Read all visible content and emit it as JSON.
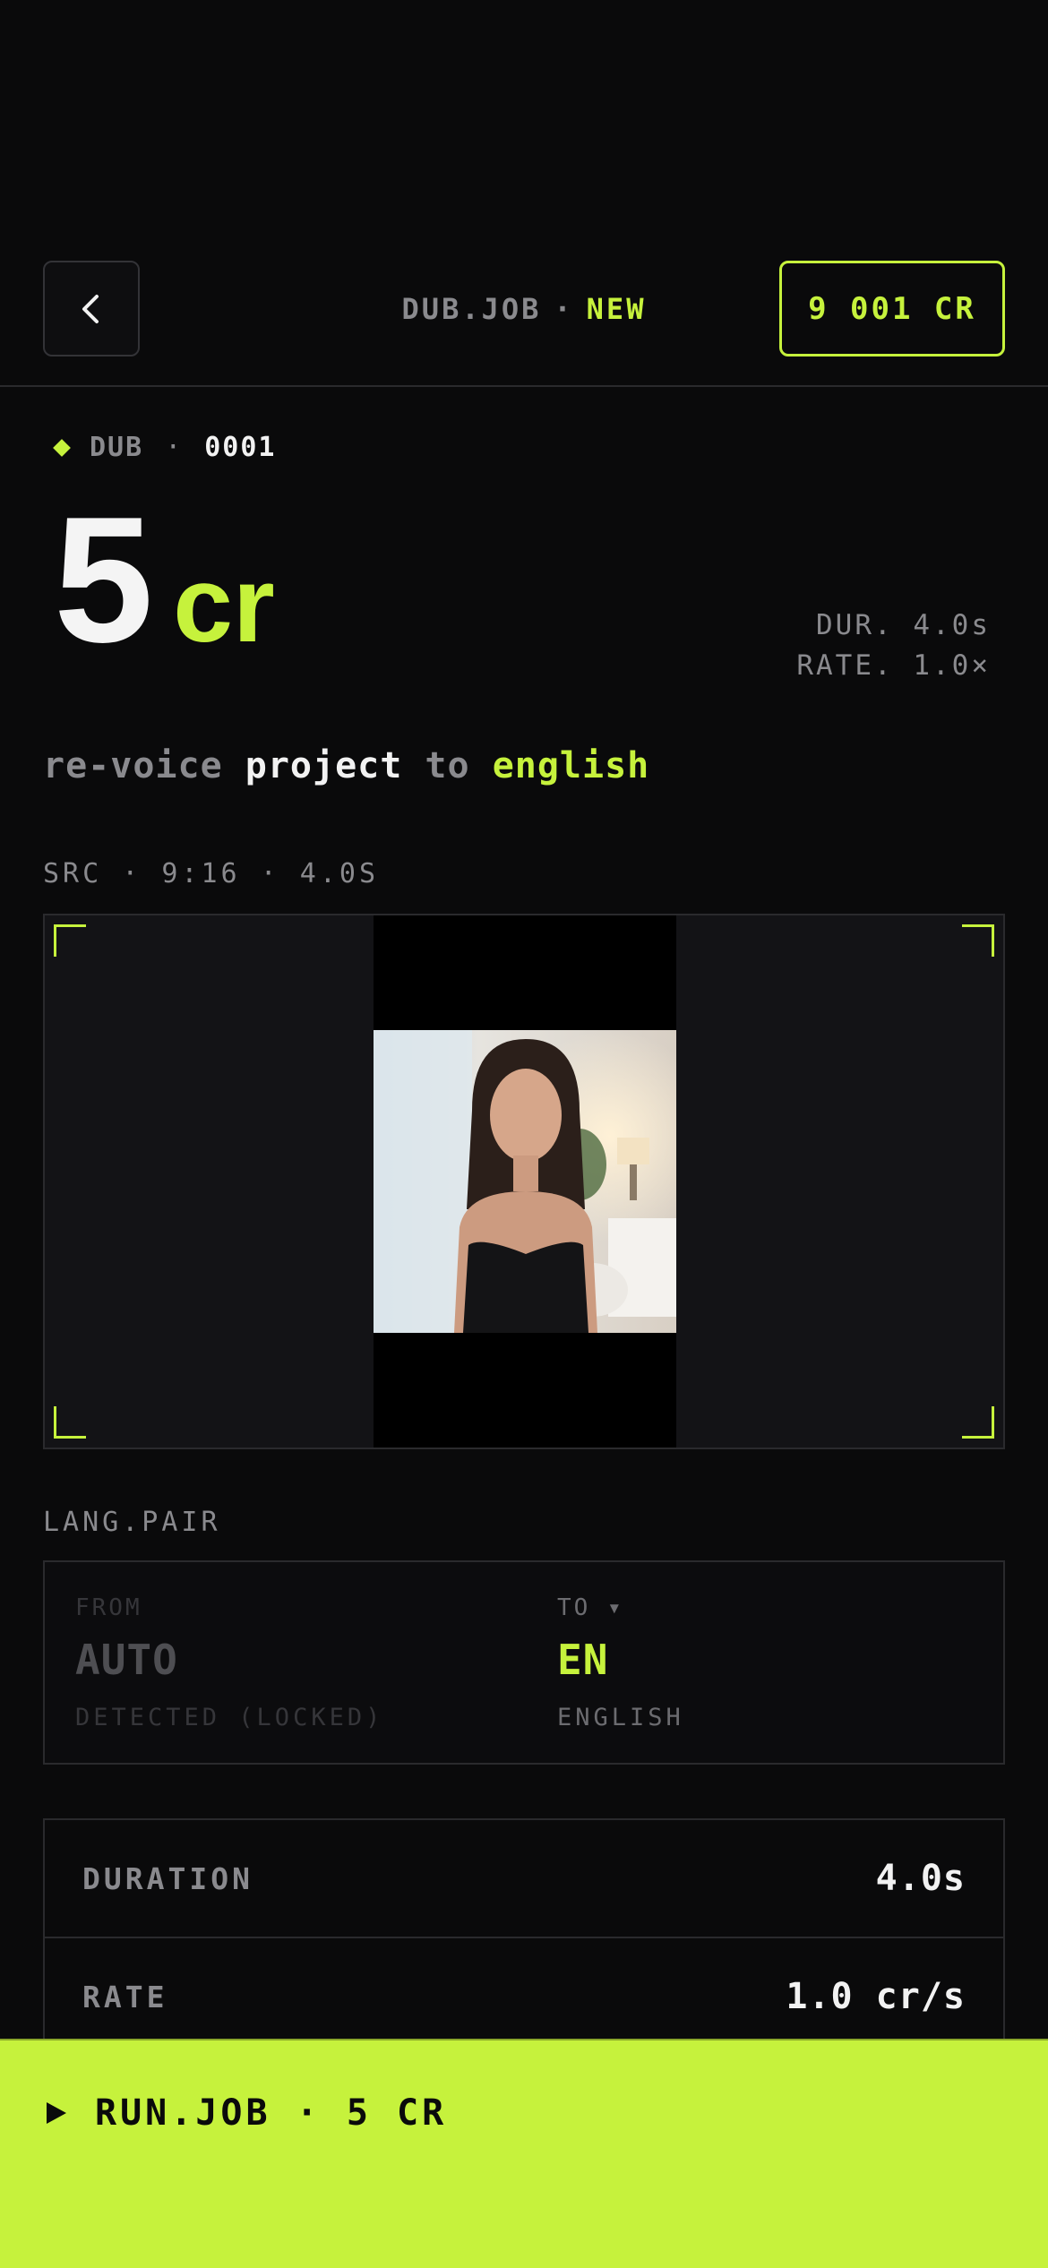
{
  "header": {
    "job_label": "DUB.JOB",
    "separator": "·",
    "job_status": "NEW",
    "credits": "9 001 CR",
    "back_icon": "chevron-left-icon"
  },
  "job": {
    "kind": "DUB",
    "separator": "·",
    "number": "0001",
    "cost_value": "5",
    "cost_unit": "cr",
    "duration_meta": "DUR. 4.0s",
    "rate_meta": "RATE. 1.0×"
  },
  "description": {
    "w1": "re-voice",
    "w2": "project",
    "w3": "to",
    "w4": "english"
  },
  "source": {
    "label": "SRC · 9:16 · 4.0S"
  },
  "language_pair": {
    "label": "LANG.PAIR",
    "from_head": "FROM",
    "from_code": "AUTO",
    "from_sub": "DETECTED (LOCKED)",
    "to_head": "TO ▾",
    "to_code": "EN",
    "to_sub": "ENGLISH"
  },
  "stats": [
    {
      "key": "DURATION",
      "value": "4.0s"
    },
    {
      "key": "RATE",
      "value": "1.0 cr/s"
    }
  ],
  "run": {
    "label": "RUN.JOB · 5 CR",
    "icon": "play-icon"
  },
  "colors": {
    "accent": "#c6f23c",
    "background": "#0a0a0b"
  }
}
